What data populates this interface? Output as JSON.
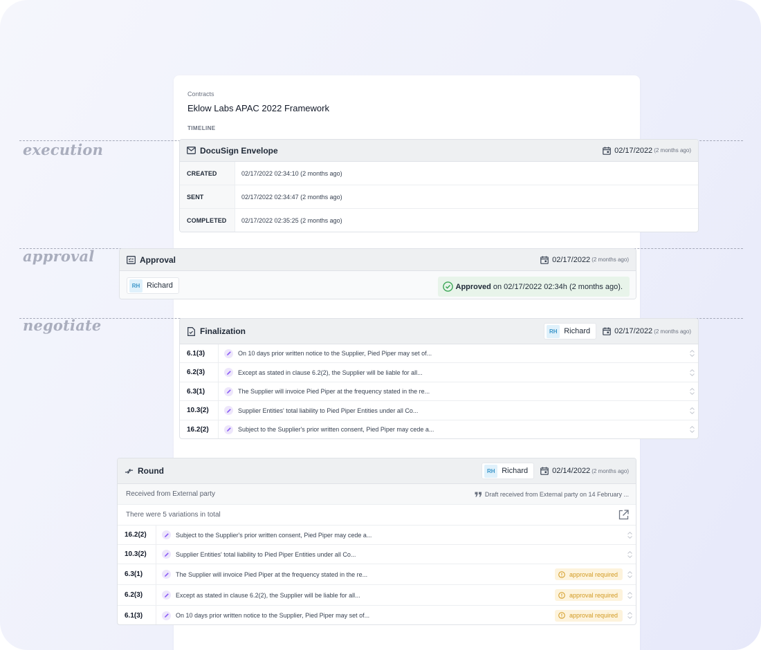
{
  "header": {
    "breadcrumb": "Contracts",
    "title": "Eklow Labs APAC 2022 Framework",
    "timeline_label": "TIMELINE"
  },
  "stages": {
    "execution": "execution",
    "approval": "approval",
    "negotiate": "negotiate"
  },
  "docusign": {
    "title": "DocuSign Envelope",
    "date": "02/17/2022",
    "ago": "(2 months ago)",
    "rows": [
      {
        "key": "CREATED",
        "value": "02/17/2022 02:34:10 (2 months ago)"
      },
      {
        "key": "SENT",
        "value": "02/17/2022 02:34:47 (2 months ago)"
      },
      {
        "key": "COMPLETED",
        "value": "02/17/2022 02:35:25 (2 months ago)"
      }
    ]
  },
  "approval": {
    "title": "Approval",
    "date": "02/17/2022",
    "ago": "(2 months ago)",
    "user_initials": "RH",
    "user_name": "Richard",
    "status_bold": "Approved",
    "status_rest": "on 02/17/2022 02:34h (2 months ago)."
  },
  "finalization": {
    "title": "Finalization",
    "user_initials": "RH",
    "user_name": "Richard",
    "date": "02/17/2022",
    "ago": "(2 months ago)",
    "clauses": [
      {
        "id": "6.1(3)",
        "text": "On 10 days prior written notice to the Supplier, Pied Piper may set of..."
      },
      {
        "id": "6.2(3)",
        "text": "Except as stated in clause 6.2(2), the Supplier will be liable for all..."
      },
      {
        "id": "6.3(1)",
        "text": "The Supplier will invoice Pied Piper at the frequency stated in the re..."
      },
      {
        "id": "10.3(2)",
        "text": "Supplier Entities' total liability to Pied Piper Entities under all Co..."
      },
      {
        "id": "16.2(2)",
        "text": "Subject to the Supplier's prior written consent, Pied Piper may cede a..."
      }
    ]
  },
  "round": {
    "title": "Round",
    "user_initials": "RH",
    "user_name": "Richard",
    "date": "02/14/2022",
    "ago": "(2 months ago)",
    "received_from": "Received from External party",
    "draft_note": "Draft received from External party on 14 February ...",
    "variations_note": "There were 5 variations in total",
    "clauses": [
      {
        "id": "16.2(2)",
        "text": "Subject to the Supplier's prior written consent, Pied Piper may cede a...",
        "badge": ""
      },
      {
        "id": "10.3(2)",
        "text": "Supplier Entities' total liability to Pied Piper Entities under all Co...",
        "badge": ""
      },
      {
        "id": "6.3(1)",
        "text": "The Supplier will invoice Pied Piper at the frequency stated in the re...",
        "badge": "approval required"
      },
      {
        "id": "6.2(3)",
        "text": "Except as stated in clause 6.2(2), the Supplier will be liable for all...",
        "badge": "approval required"
      },
      {
        "id": "6.1(3)",
        "text": "On 10 days prior written notice to the Supplier, Pied Piper may set of...",
        "badge": "approval required"
      }
    ]
  },
  "colors": {
    "accent_purple": "#8b5cf6",
    "success_green": "#3aa655",
    "warning_amber": "#d29a22",
    "initials_blue": "#3a95c9"
  }
}
